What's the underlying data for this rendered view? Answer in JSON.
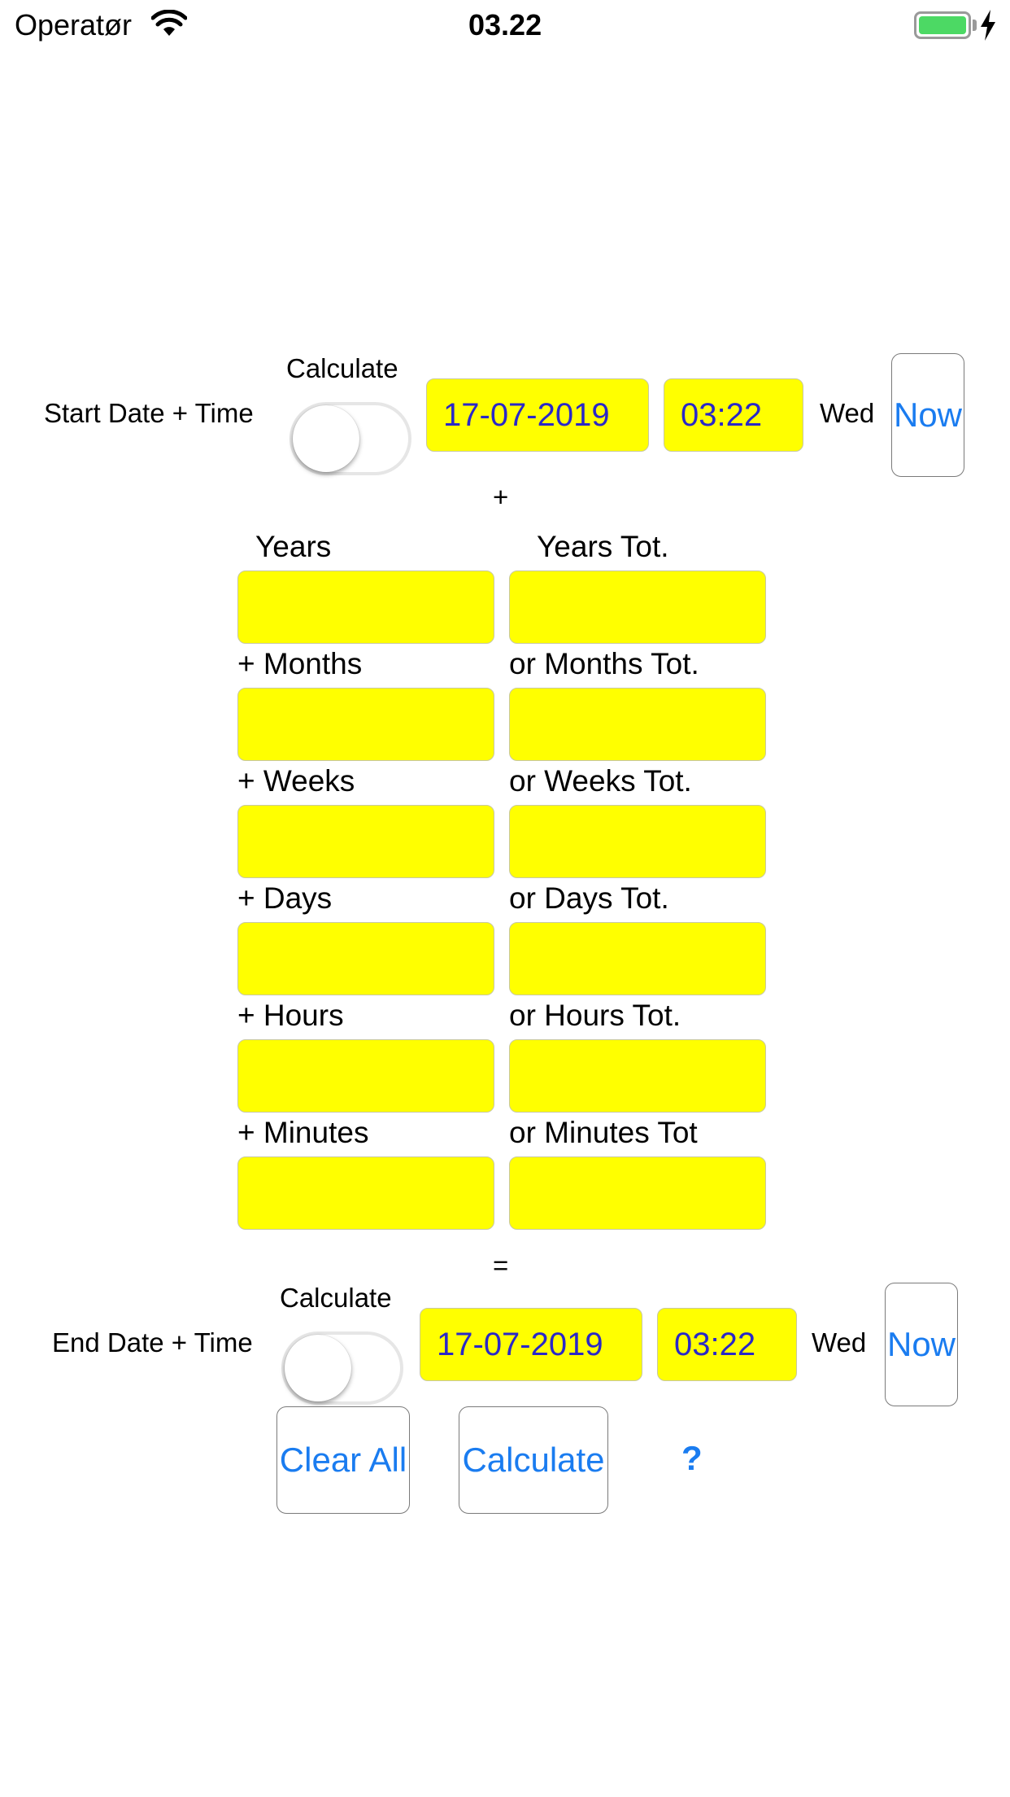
{
  "status_bar": {
    "carrier": "Operatør",
    "time": "03.22"
  },
  "start": {
    "label": "Start Date + Time",
    "calculate_label": "Calculate",
    "date": "17-07-2019",
    "time": "03:22",
    "weekday": "Wed",
    "now_label": "Now"
  },
  "plus_symbol": "+",
  "equals_symbol": "=",
  "rows": [
    {
      "left_label": "Years",
      "right_label": "Years Tot."
    },
    {
      "left_label": "+ Months",
      "right_label": "or Months Tot."
    },
    {
      "left_label": "+ Weeks",
      "right_label": "or Weeks Tot."
    },
    {
      "left_label": "+ Days",
      "right_label": "or Days Tot."
    },
    {
      "left_label": "+ Hours",
      "right_label": "or Hours Tot."
    },
    {
      "left_label": "+ Minutes",
      "right_label": "or Minutes Tot"
    }
  ],
  "end": {
    "label": "End Date + Time",
    "calculate_label": "Calculate",
    "date": "17-07-2019",
    "time": "03:22",
    "weekday": "Wed",
    "now_label": "Now"
  },
  "actions": {
    "clear_all_label": "Clear All",
    "calculate_label": "Calculate",
    "help_label": "?"
  },
  "colors": {
    "field_background": "#ffff00",
    "value_text": "#2a28c8",
    "button_text": "#1a7cf0",
    "battery": "#4cd964"
  }
}
